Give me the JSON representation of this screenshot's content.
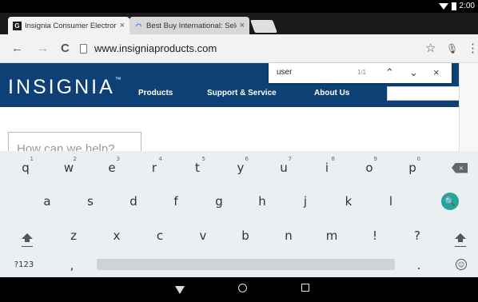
{
  "status_bar": {
    "time": "2:00"
  },
  "tabs": [
    {
      "title": "Insignia Consumer Electroni",
      "favicon": "G",
      "close": "×"
    },
    {
      "title": "Best Buy International: Sele",
      "favicon": "◠",
      "close": "×"
    }
  ],
  "toolbar": {
    "back": "←",
    "forward": "→",
    "reload": "C",
    "url": "www.insigniaproducts.com",
    "star": "☆",
    "mic": "🎙",
    "menu": "⋮"
  },
  "find_bar": {
    "query": "user",
    "count": "1/1",
    "prev": "⌃",
    "next": "⌄",
    "close": "×"
  },
  "site": {
    "logo": "INSIGNIA",
    "logo_tm": "™",
    "nav": [
      "Products",
      "Support & Service",
      "About Us"
    ],
    "help_text": "How can we help?"
  },
  "keyboard": {
    "row1": [
      {
        "k": "q",
        "h": "1"
      },
      {
        "k": "w",
        "h": "2"
      },
      {
        "k": "e",
        "h": "3"
      },
      {
        "k": "r",
        "h": "4"
      },
      {
        "k": "t",
        "h": "5"
      },
      {
        "k": "y",
        "h": "6"
      },
      {
        "k": "u",
        "h": "7"
      },
      {
        "k": "i",
        "h": "8"
      },
      {
        "k": "o",
        "h": "9"
      },
      {
        "k": "p",
        "h": "0"
      }
    ],
    "backspace_symbol": "×",
    "row2": [
      "a",
      "s",
      "d",
      "f",
      "g",
      "h",
      "j",
      "k",
      "l"
    ],
    "search_symbol": "🔍",
    "row3": [
      "z",
      "x",
      "c",
      "v",
      "b",
      "n",
      "m",
      "!",
      "?"
    ],
    "symbols_key": "?123",
    "comma_key": ",",
    "period_key": ".",
    "emoji_symbol": "☺"
  },
  "colors": {
    "brand_navy": "#0d4176",
    "accent_orange": "#f6931e",
    "keyboard_search": "#26a69a"
  }
}
